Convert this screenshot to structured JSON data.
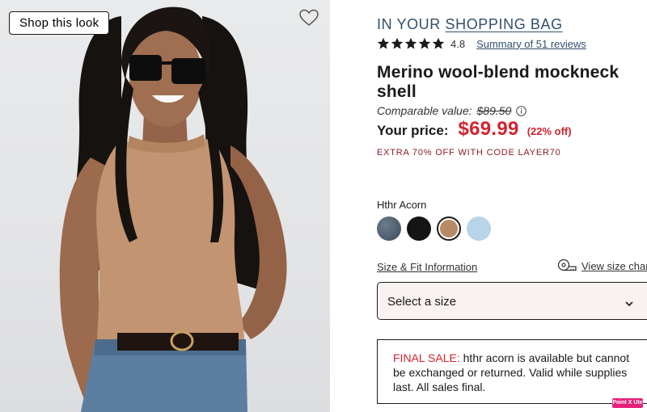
{
  "image": {
    "shop_label": "Shop this look"
  },
  "product": {
    "bag_prefix": "IN YOUR",
    "bag_link": "SHOPPING BAG",
    "rating": "4.8",
    "stars": 5,
    "reviews_link": "Summary of 51 reviews",
    "title": "Merino wool-blend mockneck shell",
    "comparable_label": "Comparable value:",
    "comparable_price": "$89.50",
    "your_price_label": "Your price:",
    "price": "$69.99",
    "discount": "(22% off)",
    "promo": "EXTRA 70% OFF WITH CODE LAYER70",
    "color_name": "Hthr Acorn",
    "swatches": [
      {
        "name": "heather-navy",
        "color": "#4a5a6a",
        "selected": false
      },
      {
        "name": "black",
        "color": "#151515",
        "selected": false
      },
      {
        "name": "hthr-acorn",
        "color": "#b98a64",
        "selected": true
      },
      {
        "name": "light-blue",
        "color": "#b8d4e8",
        "selected": false
      }
    ],
    "size_fit_link": "Size & Fit Information",
    "size_chart_link": "View size chart",
    "size_select_value": "Select a size",
    "final_sale_label": "FINAL SALE:",
    "final_sale_text": "hthr acorn is available but cannot be exchanged or returned. Valid while supplies last. All sales final.",
    "extension_badge": "Point X Ute"
  },
  "colors": {
    "accent_blue": "#334f6b",
    "price_red": "#d2232e",
    "promo_red": "#8b1e23",
    "select_bg": "#f9f2f0"
  }
}
